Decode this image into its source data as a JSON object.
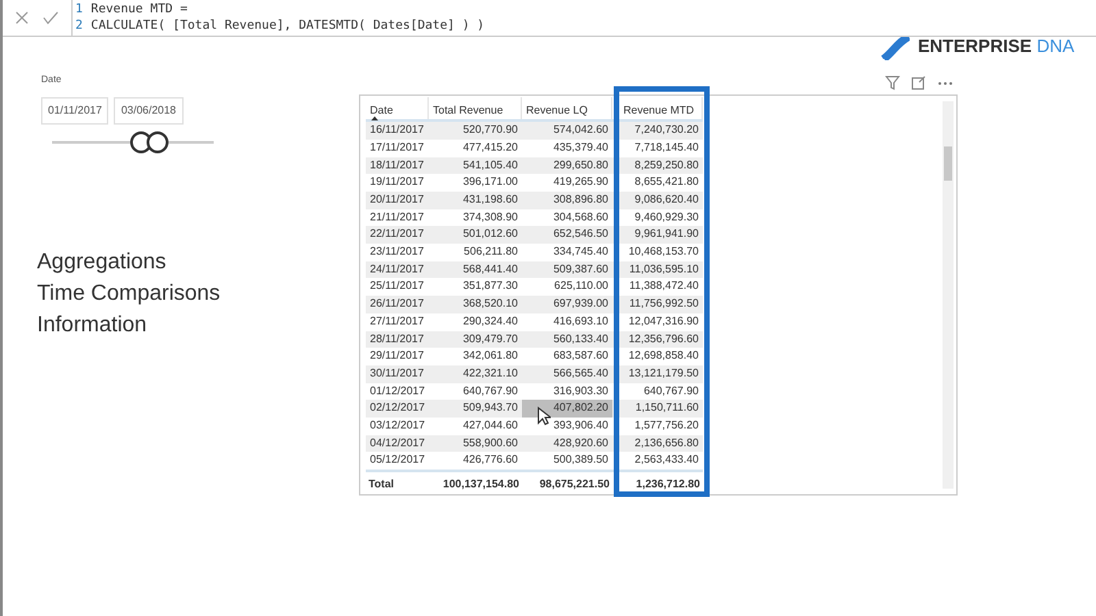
{
  "formula_bar": {
    "lines": [
      {
        "number": "1",
        "code": "Revenue MTD ="
      },
      {
        "number": "2",
        "code": "CALCULATE( [Total Revenue], DATESMTD( Dates[Date] ) )"
      }
    ]
  },
  "logo": {
    "word1": "ENTERPRISE",
    "word2": "DNA"
  },
  "slicer": {
    "label": "Date",
    "start": "01/11/2017",
    "end": "03/06/2018"
  },
  "menu_items": [
    "Aggregations",
    "Time Comparisons",
    "Information"
  ],
  "table": {
    "columns": [
      {
        "label": "Date",
        "sorted": true
      },
      {
        "label": "Total Revenue",
        "sorted": false
      },
      {
        "label": "Revenue LQ",
        "sorted": false
      },
      {
        "label": "Revenue MTD",
        "sorted": false
      }
    ],
    "rows": [
      {
        "cells": [
          "16/11/2017",
          "520,770.90",
          "574,042.60",
          "7,240,730.20"
        ],
        "hovered": false
      },
      {
        "cells": [
          "17/11/2017",
          "477,415.20",
          "435,379.40",
          "7,718,145.40"
        ],
        "hovered": false
      },
      {
        "cells": [
          "18/11/2017",
          "541,105.40",
          "299,650.80",
          "8,259,250.80"
        ],
        "hovered": false
      },
      {
        "cells": [
          "19/11/2017",
          "396,171.00",
          "419,265.90",
          "8,655,421.80"
        ],
        "hovered": false
      },
      {
        "cells": [
          "20/11/2017",
          "431,198.60",
          "308,896.80",
          "9,086,620.40"
        ],
        "hovered": false
      },
      {
        "cells": [
          "21/11/2017",
          "374,308.90",
          "304,568.60",
          "9,460,929.30"
        ],
        "hovered": false
      },
      {
        "cells": [
          "22/11/2017",
          "501,012.60",
          "652,546.50",
          "9,961,941.90"
        ],
        "hovered": false
      },
      {
        "cells": [
          "23/11/2017",
          "506,211.80",
          "334,745.40",
          "10,468,153.70"
        ],
        "hovered": false
      },
      {
        "cells": [
          "24/11/2017",
          "568,441.40",
          "509,387.60",
          "11,036,595.10"
        ],
        "hovered": false
      },
      {
        "cells": [
          "25/11/2017",
          "351,877.30",
          "625,110.00",
          "11,388,472.40"
        ],
        "hovered": false
      },
      {
        "cells": [
          "26/11/2017",
          "368,520.10",
          "697,939.00",
          "11,756,992.50"
        ],
        "hovered": false
      },
      {
        "cells": [
          "27/11/2017",
          "290,324.40",
          "416,693.10",
          "12,047,316.90"
        ],
        "hovered": false
      },
      {
        "cells": [
          "28/11/2017",
          "309,479.70",
          "560,133.40",
          "12,356,796.60"
        ],
        "hovered": false
      },
      {
        "cells": [
          "29/11/2017",
          "342,061.80",
          "683,587.60",
          "12,698,858.40"
        ],
        "hovered": false
      },
      {
        "cells": [
          "30/11/2017",
          "422,321.10",
          "566,565.40",
          "13,121,179.50"
        ],
        "hovered": false
      },
      {
        "cells": [
          "01/12/2017",
          "640,767.90",
          "316,903.30",
          "640,767.90"
        ],
        "hovered": false
      },
      {
        "cells": [
          "02/12/2017",
          "509,943.70",
          "407,802.20",
          "1,150,711.60"
        ],
        "hovered": true
      },
      {
        "cells": [
          "03/12/2017",
          "427,044.60",
          "393,906.40",
          "1,577,756.20"
        ],
        "hovered": false
      },
      {
        "cells": [
          "04/12/2017",
          "558,900.60",
          "428,920.60",
          "2,136,656.80"
        ],
        "hovered": false
      },
      {
        "cells": [
          "05/12/2017",
          "426,776.60",
          "500,389.50",
          "2,563,433.40"
        ],
        "hovered": false
      }
    ],
    "total": [
      "Total",
      "100,137,154.80",
      "98,675,221.50",
      "1,236,712.80"
    ]
  }
}
